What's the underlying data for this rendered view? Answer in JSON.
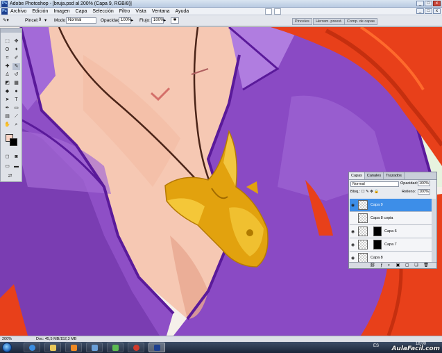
{
  "window": {
    "title": "Adobe Photoshop - [bruja.psd al 200% (Capa 9, RGB/8)]"
  },
  "menu": [
    "Archivo",
    "Edición",
    "Imagen",
    "Capa",
    "Selección",
    "Filtro",
    "Vista",
    "Ventana",
    "Ayuda"
  ],
  "options": {
    "brush_label": "Pincel:",
    "brush_size": "9",
    "mode_label": "Modo:",
    "mode_value": "Normal",
    "opacity_label": "Opacidad:",
    "opacity_value": "100%",
    "flow_label": "Flujo:",
    "flow_value": "100%"
  },
  "palette_tabs": [
    "Pinceles",
    "Herram. preest.",
    "Comp. de capas"
  ],
  "layers_panel": {
    "tabs": [
      "Capas",
      "Canales",
      "Trazados"
    ],
    "blend_mode": "Normal",
    "opacity_label": "Opacidad:",
    "opacity_value": "100%",
    "lock_label": "Bloq.:",
    "fill_label": "Relleno:",
    "fill_value": "100%",
    "layers": [
      {
        "name": "Capa 9",
        "selected": true
      },
      {
        "name": "Capa 8 copia",
        "selected": false
      },
      {
        "name": "Capa 6",
        "selected": false
      },
      {
        "name": "Capa 7",
        "selected": false
      },
      {
        "name": "Capa 8",
        "selected": false
      }
    ]
  },
  "status": {
    "zoom": "200%",
    "doc": "Doc: 45,5 MB/152,3 MB"
  },
  "taskbar": {
    "lang": "ES",
    "time": "18:00",
    "watermark": "AulaFacil.com"
  },
  "colors": {
    "foreground": "#fbd4c5",
    "background": "#000000",
    "selection": "#3d8ee8"
  }
}
